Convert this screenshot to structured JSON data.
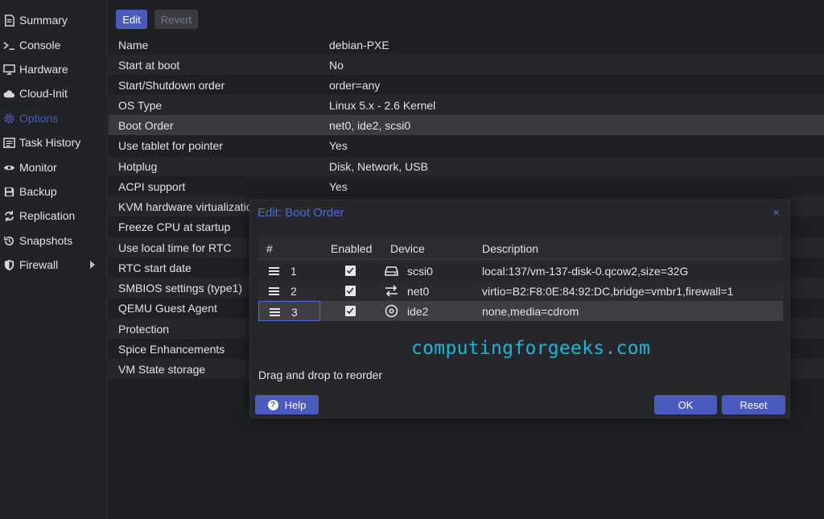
{
  "sidebar": {
    "items": [
      {
        "label": "Summary",
        "icon": "summary-icon"
      },
      {
        "label": "Console",
        "icon": "console-icon"
      },
      {
        "label": "Hardware",
        "icon": "hardware-icon"
      },
      {
        "label": "Cloud-Init",
        "icon": "cloud-icon"
      },
      {
        "label": "Options",
        "icon": "gear-icon",
        "active": true
      },
      {
        "label": "Task History",
        "icon": "task-history-icon"
      },
      {
        "label": "Monitor",
        "icon": "eye-icon"
      },
      {
        "label": "Backup",
        "icon": "backup-icon"
      },
      {
        "label": "Replication",
        "icon": "replication-icon"
      },
      {
        "label": "Snapshots",
        "icon": "history-icon"
      },
      {
        "label": "Firewall",
        "icon": "shield-icon"
      }
    ]
  },
  "toolbar": {
    "edit_label": "Edit",
    "revert_label": "Revert"
  },
  "options": {
    "rows": [
      {
        "key": "Name",
        "value": "debian-PXE"
      },
      {
        "key": "Start at boot",
        "value": "No"
      },
      {
        "key": "Start/Shutdown order",
        "value": "order=any"
      },
      {
        "key": "OS Type",
        "value": "Linux 5.x - 2.6 Kernel"
      },
      {
        "key": "Boot Order",
        "value": "net0, ide2, scsi0"
      },
      {
        "key": "Use tablet for pointer",
        "value": "Yes"
      },
      {
        "key": "Hotplug",
        "value": "Disk, Network, USB"
      },
      {
        "key": "ACPI support",
        "value": "Yes"
      },
      {
        "key": "KVM hardware virtualization",
        "value": ""
      },
      {
        "key": "Freeze CPU at startup",
        "value": ""
      },
      {
        "key": "Use local time for RTC",
        "value": ""
      },
      {
        "key": "RTC start date",
        "value": ""
      },
      {
        "key": "SMBIOS settings (type1)",
        "value": ""
      },
      {
        "key": "QEMU Guest Agent",
        "value": ""
      },
      {
        "key": "Protection",
        "value": ""
      },
      {
        "key": "Spice Enhancements",
        "value": ""
      },
      {
        "key": "VM State storage",
        "value": ""
      }
    ]
  },
  "dialog": {
    "title": "Edit: Boot Order",
    "close": "×",
    "columns": {
      "num": "#",
      "enabled": "Enabled",
      "device": "Device",
      "description": "Description"
    },
    "rows": [
      {
        "num": "1",
        "device": "scsi0",
        "icon": "hard-disk-icon",
        "description": "local:137/vm-137-disk-0.qcow2,size=32G"
      },
      {
        "num": "2",
        "device": "net0",
        "icon": "exchange-icon",
        "description": "virtio=B2:F8:0E:84:92:DC,bridge=vmbr1,firewall=1"
      },
      {
        "num": "3",
        "device": "ide2",
        "icon": "cdrom-icon",
        "description": "none,media=cdrom"
      }
    ],
    "watermark": "computingforgeeks.com",
    "hint": "Drag and drop to reorder",
    "help_label": "Help",
    "ok_label": "OK",
    "reset_label": "Reset"
  },
  "colors": {
    "accent": "#4a5bbd",
    "link": "#4f6ad6",
    "watermark": "#18b7e0"
  }
}
